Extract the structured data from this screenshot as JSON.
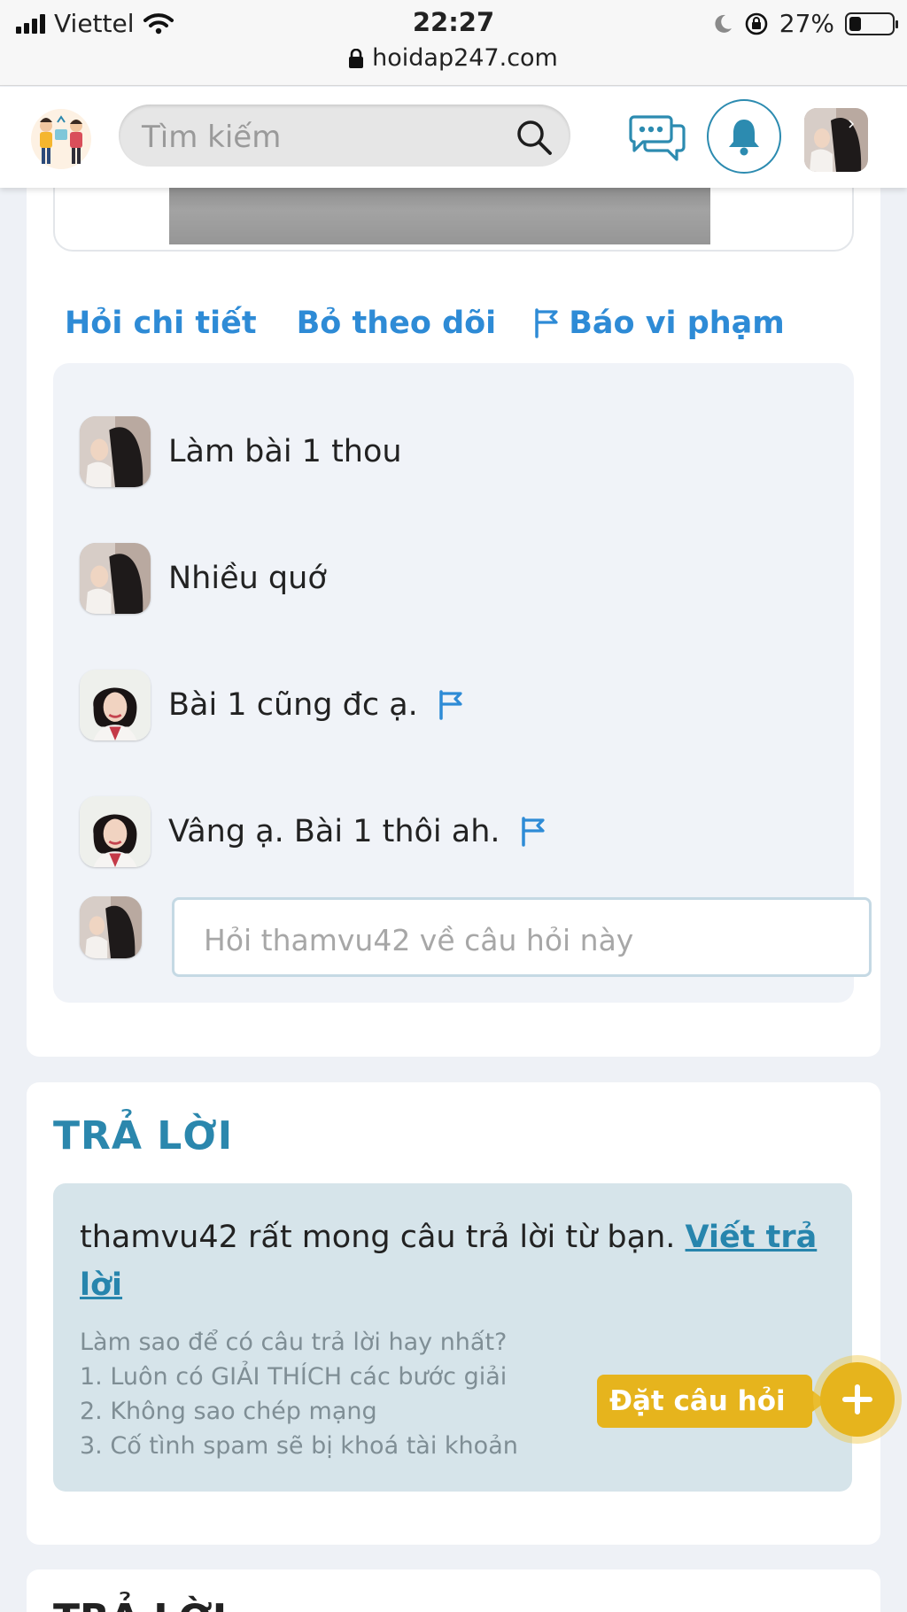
{
  "status_bar": {
    "carrier": "Viettel",
    "time": "22:27",
    "url": "hoidap247.com",
    "battery_percent": "27%",
    "battery_level": 0.27
  },
  "header": {
    "search_placeholder": "Tìm kiếm"
  },
  "actions": {
    "ask_detail": "Hỏi chi tiết",
    "unfollow": "Bỏ theo dõi",
    "report": "Báo vi phạm"
  },
  "comments": [
    {
      "text": "Làm bài 1 thou",
      "flag": false
    },
    {
      "text": "Nhiều quớ",
      "flag": false
    },
    {
      "text": "Bài 1 cũng đc ạ.",
      "flag": true
    },
    {
      "text": "Vâng ạ. Bài 1 thôi ah.",
      "flag": true
    }
  ],
  "ask_input": {
    "placeholder": "Hỏi thamvu42 về câu hỏi này"
  },
  "answer": {
    "title": "TRẢ LỜI",
    "message": "thamvu42 rất mong câu trả lời từ bạn.",
    "write_link": "Viết trả lời",
    "tips": [
      "Làm sao để có câu trả lời hay nhất?",
      "1. Luôn có GIẢI THÍCH các bước giải",
      "2. Không sao chép mạng",
      "3. Cố tình spam sẽ bị khoá tài khoản"
    ]
  },
  "fab": {
    "label": "Đặt câu hỏi"
  },
  "next_card": {
    "title": "TRẢ LỜI"
  },
  "colors": {
    "accent_blue": "#2e8bd6",
    "teal": "#2b87ad",
    "yellow": "#e6b41d"
  }
}
